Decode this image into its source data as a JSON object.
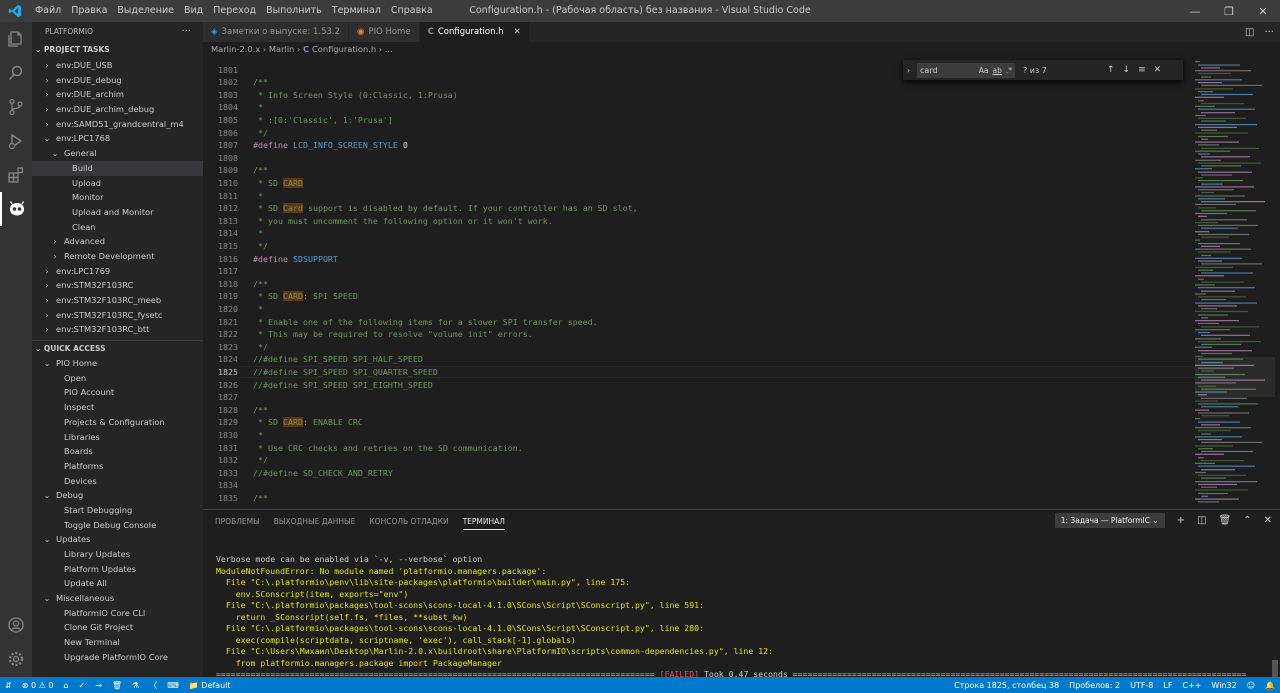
{
  "titlebar": {
    "menu": [
      "Файл",
      "Правка",
      "Выделение",
      "Вид",
      "Переход",
      "Выполнить",
      "Терминал",
      "Справка"
    ],
    "title": "Configuration.h - (Рабочая область) без названия - Visual Studio Code",
    "icons": [
      "vscode-logo",
      "minimize-icon",
      "restore-icon",
      "close-icon"
    ]
  },
  "activity_bar": {
    "icons": [
      "explorer-icon",
      "search-icon",
      "source-control-icon",
      "run-debug-icon",
      "extensions-icon",
      "platformio-icon",
      "account-icon",
      "settings-icon"
    ]
  },
  "sidebar": {
    "title": "PLATFORMIO",
    "project_tasks": {
      "heading": "PROJECT TASKS",
      "items": [
        {
          "label": "env:DUE_USB",
          "level": 1,
          "chevron": "›"
        },
        {
          "label": "env:DUE_debug",
          "level": 1,
          "chevron": "›"
        },
        {
          "label": "env:DUE_archim",
          "level": 1,
          "chevron": "›"
        },
        {
          "label": "env:DUE_archim_debug",
          "level": 1,
          "chevron": "›"
        },
        {
          "label": "env:SAMD51_grandcentral_m4",
          "level": 1,
          "chevron": "›"
        },
        {
          "label": "env:LPC1768",
          "level": 1,
          "chevron": "⌄"
        },
        {
          "label": "General",
          "level": 2,
          "chevron": "⌄"
        },
        {
          "label": "Build",
          "level": 3,
          "chevron": "",
          "selected": true
        },
        {
          "label": "Upload",
          "level": 3,
          "chevron": ""
        },
        {
          "label": "Monitor",
          "level": 3,
          "chevron": ""
        },
        {
          "label": "Upload and Monitor",
          "level": 3,
          "chevron": ""
        },
        {
          "label": "Clean",
          "level": 3,
          "chevron": ""
        },
        {
          "label": "Advanced",
          "level": 2,
          "chevron": "›"
        },
        {
          "label": "Remote Development",
          "level": 2,
          "chevron": "›"
        },
        {
          "label": "env:LPC1769",
          "level": 1,
          "chevron": "›"
        },
        {
          "label": "env:STM32F103RC",
          "level": 1,
          "chevron": "›"
        },
        {
          "label": "env:STM32F103RC_meeb",
          "level": 1,
          "chevron": "›"
        },
        {
          "label": "env:STM32F103RC_fysetc",
          "level": 1,
          "chevron": "›"
        },
        {
          "label": "env:STM32F103RC_btt",
          "level": 1,
          "chevron": "›"
        }
      ]
    },
    "quick_access": {
      "heading": "QUICK ACCESS",
      "items": [
        {
          "label": "PIO Home",
          "level": 1,
          "chevron": "⌄"
        },
        {
          "label": "Open",
          "level": 2,
          "chevron": ""
        },
        {
          "label": "PIO Account",
          "level": 2,
          "chevron": ""
        },
        {
          "label": "Inspect",
          "level": 2,
          "chevron": ""
        },
        {
          "label": "Projects & Configuration",
          "level": 2,
          "chevron": ""
        },
        {
          "label": "Libraries",
          "level": 2,
          "chevron": ""
        },
        {
          "label": "Boards",
          "level": 2,
          "chevron": ""
        },
        {
          "label": "Platforms",
          "level": 2,
          "chevron": ""
        },
        {
          "label": "Devices",
          "level": 2,
          "chevron": ""
        },
        {
          "label": "Debug",
          "level": 1,
          "chevron": "⌄"
        },
        {
          "label": "Start Debugging",
          "level": 2,
          "chevron": ""
        },
        {
          "label": "Toggle Debug Console",
          "level": 2,
          "chevron": ""
        },
        {
          "label": "Updates",
          "level": 1,
          "chevron": "⌄"
        },
        {
          "label": "Library Updates",
          "level": 2,
          "chevron": ""
        },
        {
          "label": "Platform Updates",
          "level": 2,
          "chevron": ""
        },
        {
          "label": "Update All",
          "level": 2,
          "chevron": ""
        },
        {
          "label": "Miscellaneous",
          "level": 1,
          "chevron": "⌄"
        },
        {
          "label": "PlatformIO Core CLI",
          "level": 2,
          "chevron": ""
        },
        {
          "label": "Clone Git Project",
          "level": 2,
          "chevron": ""
        },
        {
          "label": "New Terminal",
          "level": 2,
          "chevron": ""
        },
        {
          "label": "Upgrade PlatformIO Core",
          "level": 2,
          "chevron": ""
        }
      ]
    }
  },
  "editor": {
    "tabs": [
      {
        "label": "Заметки о выпуске: 1.53.2",
        "icon": "vscode-icon",
        "active": false
      },
      {
        "label": "PIO Home",
        "icon": "platformio-tab-icon",
        "active": false
      },
      {
        "label": "Configuration.h",
        "icon": "c-file-icon",
        "active": true
      }
    ],
    "breadcrumb": [
      "Marlin-2.0.x",
      "Marlin",
      "Configuration.h",
      "..."
    ],
    "find": {
      "query": "card",
      "result": "? из 7",
      "opt_case": "Aa",
      "opt_word": "ab",
      "opt_regex": ".*"
    },
    "current_line": 1825,
    "lines": [
      {
        "n": 1801,
        "seg": []
      },
      {
        "n": 1802,
        "seg": [
          [
            "cm",
            "/**"
          ]
        ]
      },
      {
        "n": 1803,
        "seg": [
          [
            "cm",
            " * Info Screen Style (0:Classic, 1:Prusa)"
          ]
        ]
      },
      {
        "n": 1804,
        "seg": [
          [
            "cm",
            " *"
          ]
        ]
      },
      {
        "n": 1805,
        "seg": [
          [
            "cm",
            " * :[0:'Classic', 1:'Prusa']"
          ]
        ]
      },
      {
        "n": 1806,
        "seg": [
          [
            "cm",
            " */"
          ]
        ]
      },
      {
        "n": 1807,
        "seg": [
          [
            "kw",
            "#define"
          ],
          [
            "tx",
            " "
          ],
          [
            "mc",
            "LCD_INFO_SCREEN_STYLE"
          ],
          [
            "tx",
            " "
          ],
          [
            "num",
            "0"
          ]
        ]
      },
      {
        "n": 1808,
        "seg": []
      },
      {
        "n": 1809,
        "seg": [
          [
            "cm",
            "/**"
          ]
        ]
      },
      {
        "n": 1810,
        "seg": [
          [
            "cm",
            " * SD "
          ],
          [
            "hl",
            "CARD"
          ]
        ]
      },
      {
        "n": 1811,
        "seg": [
          [
            "cm",
            " *"
          ]
        ]
      },
      {
        "n": 1812,
        "seg": [
          [
            "cm",
            " * SD "
          ],
          [
            "hl",
            "Card"
          ],
          [
            "cm",
            " support is disabled by default. If your controller has an SD slot,"
          ]
        ]
      },
      {
        "n": 1813,
        "seg": [
          [
            "cm",
            " * you must uncomment the following option or it won't work."
          ]
        ]
      },
      {
        "n": 1814,
        "seg": [
          [
            "cm",
            " *"
          ]
        ]
      },
      {
        "n": 1815,
        "seg": [
          [
            "cm",
            " */"
          ]
        ]
      },
      {
        "n": 1816,
        "seg": [
          [
            "kw",
            "#define"
          ],
          [
            "tx",
            " "
          ],
          [
            "mc",
            "SDSUPPORT"
          ]
        ]
      },
      {
        "n": 1817,
        "seg": []
      },
      {
        "n": 1818,
        "seg": [
          [
            "cm",
            "/**"
          ]
        ]
      },
      {
        "n": 1819,
        "seg": [
          [
            "cm",
            " * SD "
          ],
          [
            "hl",
            "CARD"
          ],
          [
            "cm",
            ": SPI SPEED"
          ]
        ]
      },
      {
        "n": 1820,
        "seg": [
          [
            "cm",
            " *"
          ]
        ]
      },
      {
        "n": 1821,
        "seg": [
          [
            "cm",
            " * Enable one of the following items for a slower SPI transfer speed."
          ]
        ]
      },
      {
        "n": 1822,
        "seg": [
          [
            "cm",
            " * This may be required to resolve \"volume init\" errors."
          ]
        ]
      },
      {
        "n": 1823,
        "seg": [
          [
            "cm",
            " */"
          ]
        ]
      },
      {
        "n": 1824,
        "seg": [
          [
            "cm",
            "//#define SPI_SPEED SPI_HALF_SPEED"
          ]
        ]
      },
      {
        "n": 1825,
        "seg": [
          [
            "cm",
            "//#define SPI_SPEED SPI_QUARTER_SPEED"
          ]
        ]
      },
      {
        "n": 1826,
        "seg": [
          [
            "cm",
            "//#define SPI_SPEED SPI_EIGHTH_SPEED"
          ]
        ]
      },
      {
        "n": 1827,
        "seg": []
      },
      {
        "n": 1828,
        "seg": [
          [
            "cm",
            "/**"
          ]
        ]
      },
      {
        "n": 1829,
        "seg": [
          [
            "cm",
            " * SD "
          ],
          [
            "hl",
            "CARD"
          ],
          [
            "cm",
            ": ENABLE CRC"
          ]
        ]
      },
      {
        "n": 1830,
        "seg": [
          [
            "cm",
            " *"
          ]
        ]
      },
      {
        "n": 1831,
        "seg": [
          [
            "cm",
            " * Use CRC checks and retries on the SD communication."
          ]
        ]
      },
      {
        "n": 1832,
        "seg": [
          [
            "cm",
            " */"
          ]
        ]
      },
      {
        "n": 1833,
        "seg": [
          [
            "cm",
            "//#define SD_CHECK_AND_RETRY"
          ]
        ]
      },
      {
        "n": 1834,
        "seg": []
      },
      {
        "n": 1835,
        "seg": [
          [
            "cm",
            "/**"
          ]
        ]
      }
    ]
  },
  "panel": {
    "tabs": [
      "ПРОБЛЕМЫ",
      "ВЫХОДНЫЕ ДАННЫЕ",
      "КОНСОЛЬ ОТЛАДКИ",
      "ТЕРМИНАЛ"
    ],
    "active_tab": "ТЕРМИНАЛ",
    "task_select": "1: Задача — PlatformIC",
    "terminal_lines": [
      {
        "c": "tw",
        "t": "Verbose mode can be enabled via `-v, --verbose` option"
      },
      {
        "c": "ty",
        "t": "ModuleNotFoundError: No module named 'platformio.managers.package':"
      },
      {
        "c": "ty",
        "t": "  File \"C:\\.platformio\\penv\\lib\\site-packages\\platformio\\builder\\main.py\", line 175:"
      },
      {
        "c": "ty",
        "t": "    env.SConscript(item, exports=\"env\")"
      },
      {
        "c": "ty",
        "t": "  File \"C:\\.platformio\\packages\\tool-scons\\scons-local-4.1.0\\SCons\\Script\\SConscript.py\", line 591:"
      },
      {
        "c": "ty",
        "t": "    return _SConscript(self.fs, *files, **subst_kw)"
      },
      {
        "c": "ty",
        "t": "  File \"C:\\.platformio\\packages\\tool-scons\\scons-local-4.1.0\\SCons\\Script\\SConscript.py\", line 280:"
      },
      {
        "c": "ty",
        "t": "    exec(compile(scriptdata, scriptname, 'exec'), call_stack[-1].globals)"
      },
      {
        "c": "ty",
        "t": "  File \"C:\\Users\\Михаил\\Desktop\\Marlin-2.0.x\\buildroot\\share\\PlatformIO\\scripts\\common-dependencies.py\", line 12:"
      },
      {
        "c": "ty",
        "t": "    from platformio.managers.package import PackageManager"
      }
    ],
    "final_line": {
      "left": "========================================================================================= ",
      "failed": "[FAILED]",
      "right": " Took 0.47 seconds ============================================================================================"
    }
  },
  "statusbar": {
    "remote": "",
    "errors": "0",
    "warnings": "0",
    "env": "Default",
    "position": "Строка 1825, столбец 38",
    "spaces": "Пробелов: 2",
    "encoding": "UTF-8",
    "eol": "LF",
    "language": "C++",
    "platform": "Win32"
  },
  "colors": {
    "accent": "#007acc",
    "comment": "#6a9955",
    "keyword": "#c586c0",
    "macro": "#569cd6",
    "number": "#b5cea8",
    "find_highlight": "#613214",
    "terminal_yellow": "#e5e510",
    "terminal_red": "#f14c4c"
  }
}
